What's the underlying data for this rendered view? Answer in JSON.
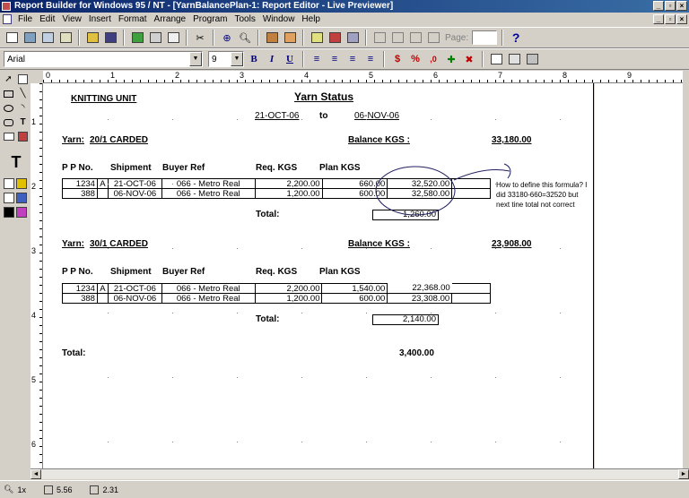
{
  "window": {
    "title": "Report Builder for Windows 95 / NT - [YarnBalancePlan-1: Report Editor - Live Previewer]",
    "controls": [
      "_",
      "▫",
      "×"
    ]
  },
  "menubar": {
    "items": [
      "File",
      "Edit",
      "View",
      "Insert",
      "Format",
      "Arrange",
      "Program",
      "Tools",
      "Window",
      "Help"
    ]
  },
  "toolbar": {
    "page_label": "Page:",
    "page_value": "",
    "help_glyph": "?"
  },
  "format_bar": {
    "font_name": "Arial",
    "font_size": "9",
    "bold": "B",
    "italic": "I",
    "underline": "U",
    "currency": "$",
    "percent": "%",
    "comma": ",0"
  },
  "rulers": {
    "horizontal": [
      "0",
      "1",
      "2",
      "3",
      "4",
      "5",
      "6",
      "7",
      "8",
      "9"
    ],
    "vertical": [
      "1",
      "2",
      "3",
      "4",
      "5",
      "6"
    ]
  },
  "report": {
    "unit": "KNITTING UNIT",
    "title": "Yarn Status",
    "date_from": "21-OCT-06",
    "date_to_label": "to",
    "date_to": "06-NOV-06",
    "columns": [
      "P P No.",
      "Shipment",
      "Buyer Ref",
      "Req. KGS",
      "Plan KGS"
    ],
    "groups": [
      {
        "yarn_label": "Yarn:",
        "yarn_name": "20/1 CARDED",
        "balance_label": "Balance KGS :",
        "balance_value": "33,180.00",
        "rows": [
          {
            "pp": "1234",
            "flag": "A",
            "shipment": "21-OCT-06",
            "buyer": "066 - Metro Real",
            "req": "2,200.00",
            "plan": "660.00",
            "balance": "32,520.00"
          },
          {
            "pp": "388",
            "flag": "",
            "shipment": "06-NOV-06",
            "buyer": "066 - Metro Real",
            "req": "1,200.00",
            "plan": "600.00",
            "balance": "32,580.00"
          }
        ],
        "total_label": "Total:",
        "total_value": "1,260.00"
      },
      {
        "yarn_label": "Yarn:",
        "yarn_name": "30/1 CARDED",
        "balance_label": "Balance KGS :",
        "balance_value": "23,908.00",
        "rows": [
          {
            "pp": "1234",
            "flag": "A",
            "shipment": "21-OCT-06",
            "buyer": "066 - Metro Real",
            "req": "2,200.00",
            "plan": "1,540.00",
            "balance": "22,368.00"
          },
          {
            "pp": "388",
            "flag": "",
            "shipment": "06-NOV-06",
            "buyer": "066 - Metro Real",
            "req": "1,200.00",
            "plan": "600.00",
            "balance": "23,308.00"
          }
        ],
        "total_label": "Total:",
        "total_value": "2,140.00"
      }
    ],
    "grand_total_label": "Total:",
    "grand_total_value": "3,400.00",
    "annotation": [
      "How to define this formula? I",
      "did 33180-660=32520 but",
      "next tine total not correct"
    ]
  },
  "statusbar": {
    "zoom": "1x",
    "x": "5.56",
    "y": "2.31"
  }
}
